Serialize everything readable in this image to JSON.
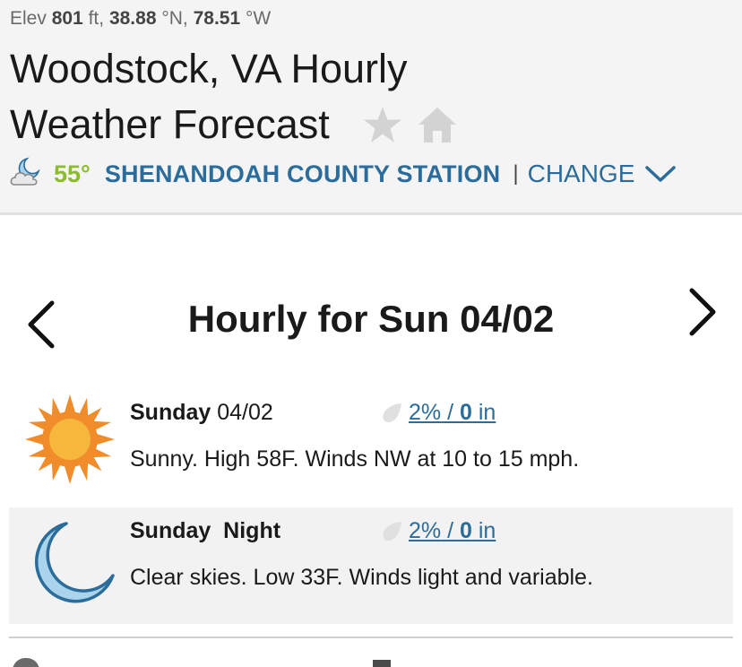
{
  "header": {
    "elev_label": "Elev",
    "elev_value": "801",
    "elev_unit": "ft,",
    "lat_value": "38.88",
    "lat_unit": "°N,",
    "lon_value": "78.51",
    "lon_unit": "°W",
    "title": "Woodstock, VA Hourly Weather Forecast",
    "icons": [
      "star-icon",
      "home-icon"
    ]
  },
  "current": {
    "icon": "partly-cloudy-night-icon",
    "temp": "55°",
    "station": "SHENANDOAH COUNTY STATION",
    "separator": "|",
    "change_label": "CHANGE",
    "change_icon": "chevron-down-icon"
  },
  "nav": {
    "title": "Hourly for Sun 04/02",
    "prev_icon": "chevron-left-icon",
    "next_icon": "chevron-right-icon"
  },
  "forecast": [
    {
      "icon": "sun-icon",
      "day": "Sunday",
      "date": "04/02",
      "precip_icon": "raindrop-icon",
      "precip_pct": "2%",
      "precip_sep": " / ",
      "precip_amt": "0",
      "precip_unit": " in",
      "description": "Sunny. High 58F. Winds NW at 10 to 15 mph."
    },
    {
      "icon": "moon-icon",
      "day": "Sunday  Night",
      "date": "",
      "precip_icon": "raindrop-icon",
      "precip_pct": "2%",
      "precip_sep": " / ",
      "precip_amt": "0",
      "precip_unit": " in",
      "description": "Clear skies. Low 33F. Winds light and variable."
    }
  ],
  "colors": {
    "accent_blue": "#2b6c9a",
    "temp_green": "#8bbd2a",
    "sun_orange": "#f08c2a",
    "sun_yellow": "#f6b73c",
    "moon_blue": "#a9d4ec"
  }
}
